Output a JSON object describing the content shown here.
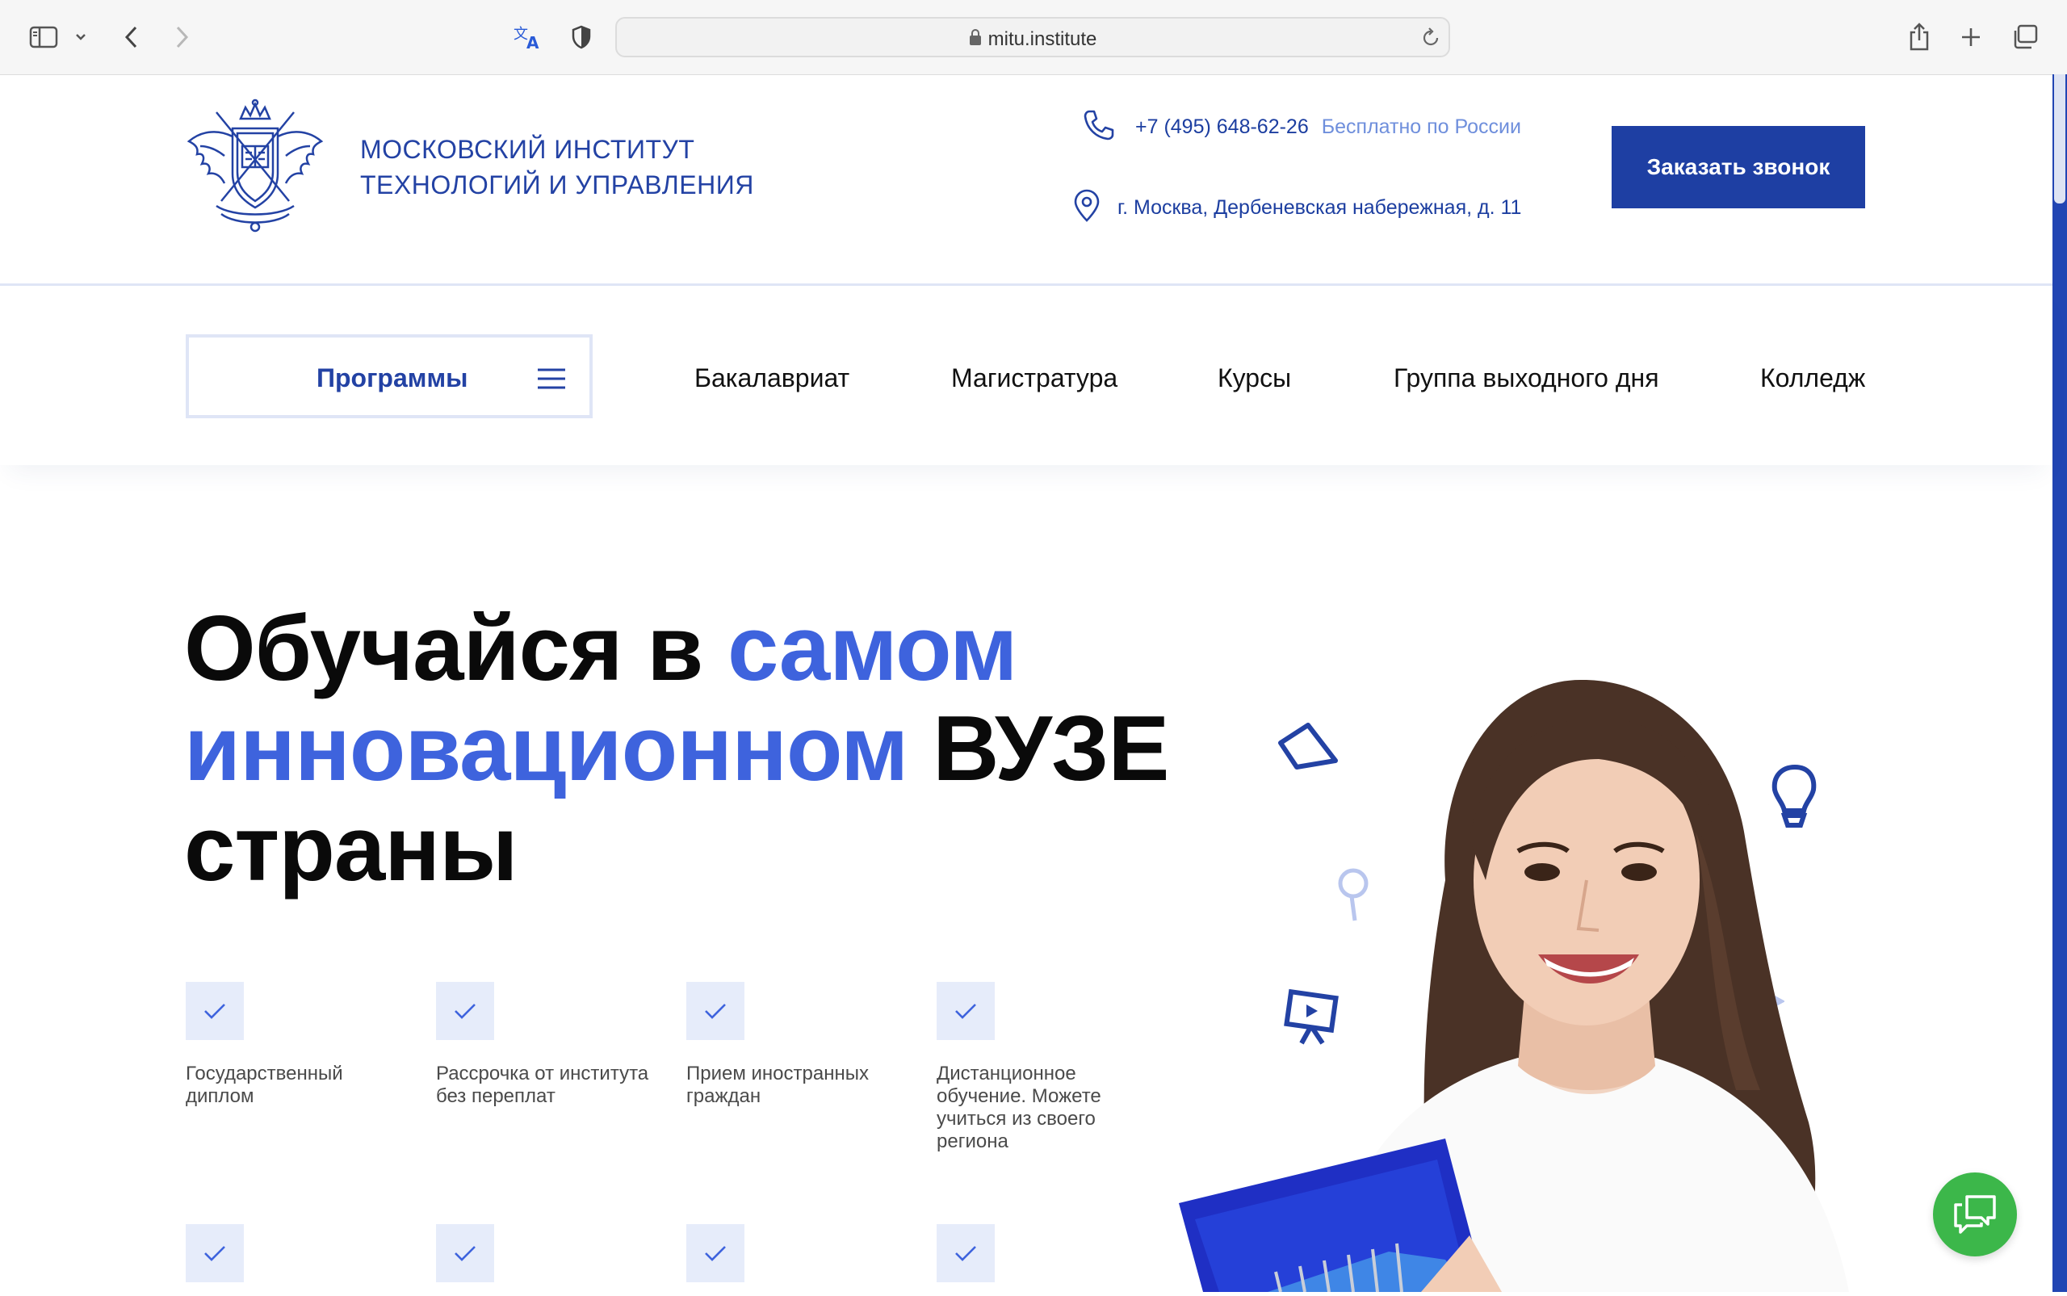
{
  "browser": {
    "url": "mitu.institute",
    "icons": [
      "sidebar-icon",
      "chevron-down-icon",
      "back-icon",
      "forward-icon",
      "translate-icon",
      "privacy-shield-icon",
      "lock-icon",
      "reload-icon",
      "share-icon",
      "new-tab-icon",
      "tabs-overview-icon"
    ]
  },
  "header": {
    "inst_name_line1": "МОСКОВСКИЙ ИНСТИТУТ",
    "inst_name_line2": "ТЕХНОЛОГИЙ И УПРАВЛЕНИЯ",
    "phone": "+7 (495) 648-62-26",
    "phone_note": "Бесплатно по России",
    "address": "г. Москва, Дербеневская набережная, д. 11",
    "call_button": "Заказать звонок"
  },
  "nav": {
    "programs": "Программы",
    "items": [
      "Бакалавриат",
      "Магистратура",
      "Курсы",
      "Группа выходного дня",
      "Колледж"
    ]
  },
  "hero": {
    "title_part1": "Обучайся в ",
    "title_accent": "самом инновационном",
    "title_part2": " ВУЗЕ страны",
    "features": [
      "Государственный диплом",
      "Рассрочка от института без переплат",
      "Прием иностранных граждан",
      "Дистанционное обучение. Можете учиться из своего региона"
    ]
  },
  "colors": {
    "brand_blue": "#1e3fa3",
    "accent_blue": "#3e63dd",
    "light_blue": "#e6ecfa",
    "chat_green": "#3cb74a"
  }
}
